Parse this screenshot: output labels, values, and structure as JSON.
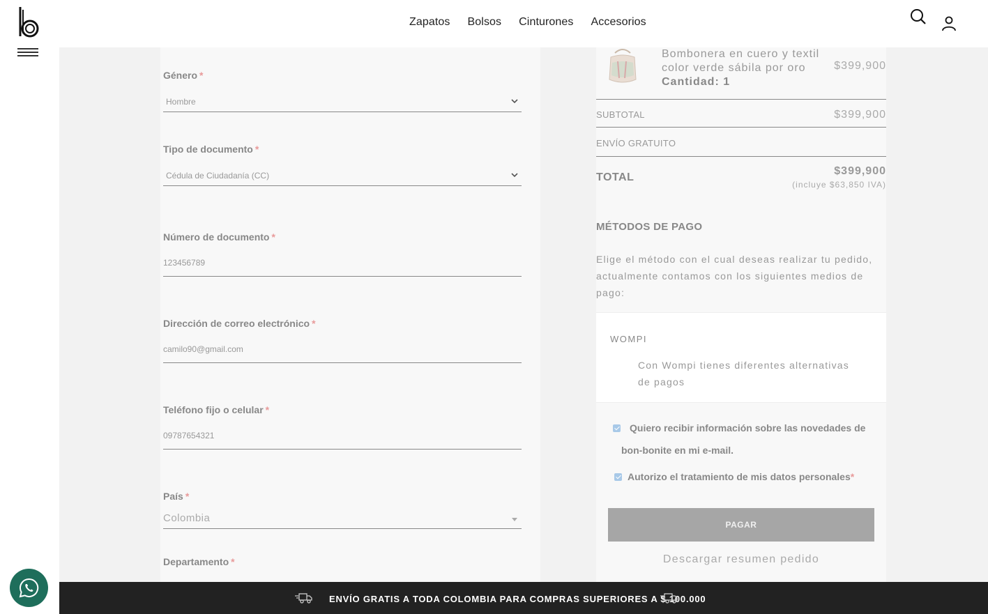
{
  "nav": {
    "items": [
      "Zapatos",
      "Bolsos",
      "Cinturones",
      "Accesorios"
    ]
  },
  "form": {
    "gender": {
      "label": "Género",
      "value": "Hombre"
    },
    "doc_type": {
      "label": "Tipo de documento",
      "value": "Cédula de Ciudadanía (CC)"
    },
    "doc_number": {
      "label": "Número de documento",
      "value": "123456789"
    },
    "email": {
      "label": "Dirección de correo electrónico",
      "value": "camilo90@gmail.com"
    },
    "phone": {
      "label": "Teléfono fijo o celular",
      "value": "09787654321"
    },
    "country": {
      "label": "País",
      "value": "Colombia"
    },
    "department": {
      "label": "Departamento"
    },
    "required_mark": "*"
  },
  "order": {
    "product_name": "Bombonera en cuero y textil color verde sábila por oro",
    "quantity_label": "Cantidad: 1",
    "product_price": "$399,900",
    "subtotal_label": "SUBTOTAL",
    "subtotal_value": "$399,900",
    "shipping_label": "ENVÍO GRATUITO",
    "total_label": "TOTAL",
    "total_value": "$399,900",
    "iva_note": "(incluye $63,850 IVA)"
  },
  "payment": {
    "title": "MÉTODOS DE PAGO",
    "description": "Elige el método con el cual deseas realizar tu pedido, actualmente contamos con los siguientes medios de pago:",
    "method_name": "WOMPI",
    "method_desc": "Con Wompi tienes diferentes alternativas de pagos",
    "newsletter_consent": "Quiero recibir información sobre las novedades de bon-bonite en mi e-mail.",
    "data_consent": "Autorizo el tratamiento de mis datos personales",
    "pay_button": "PAGAR",
    "download_link": "Descargar resumen pedido"
  },
  "footer_banner": "ENVÍO GRATIS A TODA COLOMBIA PARA COMPRAS SUPERIORES A $ 100.000",
  "colors": {
    "accent_whatsapp": "#1e6e5b",
    "banner_bg": "#222222",
    "required": "#e89a9a"
  }
}
